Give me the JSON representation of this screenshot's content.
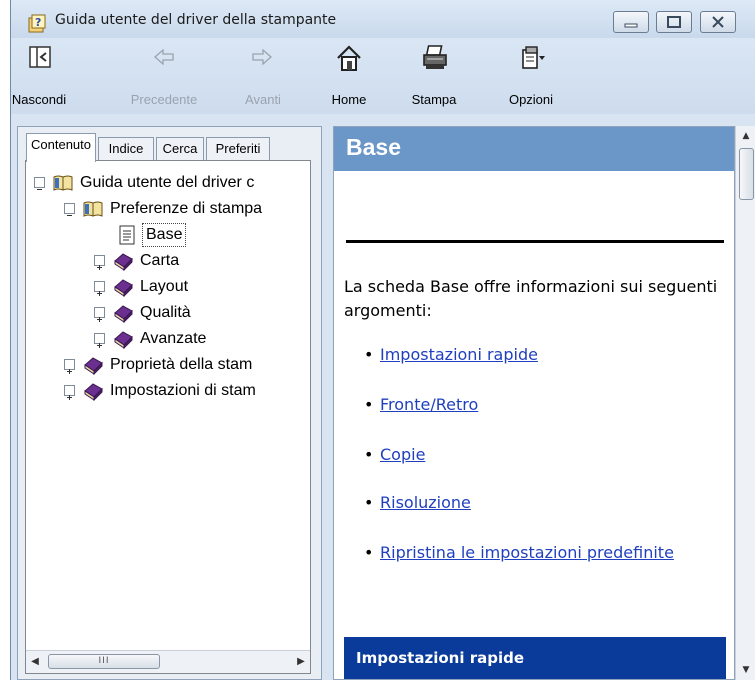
{
  "window": {
    "title": "Guida utente del driver della stampante"
  },
  "toolbar": {
    "buttons": [
      {
        "label": "Nascondi",
        "icon": "hide-pane-icon",
        "enabled": true
      },
      {
        "label": "Precedente",
        "icon": "back-arrow-icon",
        "enabled": false
      },
      {
        "label": "Avanti",
        "icon": "forward-arrow-icon",
        "enabled": false
      },
      {
        "label": "Home",
        "icon": "home-icon",
        "enabled": true
      },
      {
        "label": "Stampa",
        "icon": "printer-icon",
        "enabled": true
      },
      {
        "label": "Opzioni",
        "icon": "options-icon",
        "enabled": true
      }
    ]
  },
  "nav_tabs": [
    "Contenuto",
    "Indice",
    "Cerca",
    "Preferiti"
  ],
  "active_tab": "Contenuto",
  "tree": [
    {
      "label": "Guida utente del driver c",
      "expander": "minus",
      "icon": "open-book-icon"
    },
    {
      "label": "Preferenze di stampa",
      "expander": "minus",
      "icon": "open-book-icon"
    },
    {
      "label": "Base",
      "expander": "",
      "icon": "page-icon",
      "selected": true
    },
    {
      "label": "Carta",
      "expander": "plus",
      "icon": "closed-book-icon"
    },
    {
      "label": "Layout",
      "expander": "plus",
      "icon": "closed-book-icon"
    },
    {
      "label": "Qualità",
      "expander": "plus",
      "icon": "closed-book-icon"
    },
    {
      "label": "Avanzate",
      "expander": "plus",
      "icon": "closed-book-icon"
    },
    {
      "label": "Proprietà della stam",
      "expander": "plus",
      "icon": "closed-book-icon"
    },
    {
      "label": "Impostazioni di stam",
      "expander": "plus",
      "icon": "closed-book-icon"
    }
  ],
  "content": {
    "heading": "Base",
    "intro": "La scheda Base offre informazioni sui seguenti argomenti:",
    "topics": [
      "Impostazioni rapide",
      "Fronte/Retro",
      "Copie",
      "Risoluzione",
      "Ripristina le impostazioni predefinite"
    ],
    "section_heading": "Impostazioni rapide"
  },
  "scrollbar_glyphs": {
    "left": "◀",
    "right": "▶",
    "up": "▲",
    "down": "▼",
    "grip": "III"
  },
  "colors": {
    "heading_bar": "#6a96c8",
    "section_bar": "#0a3a9a",
    "link": "#1f3fbf"
  }
}
